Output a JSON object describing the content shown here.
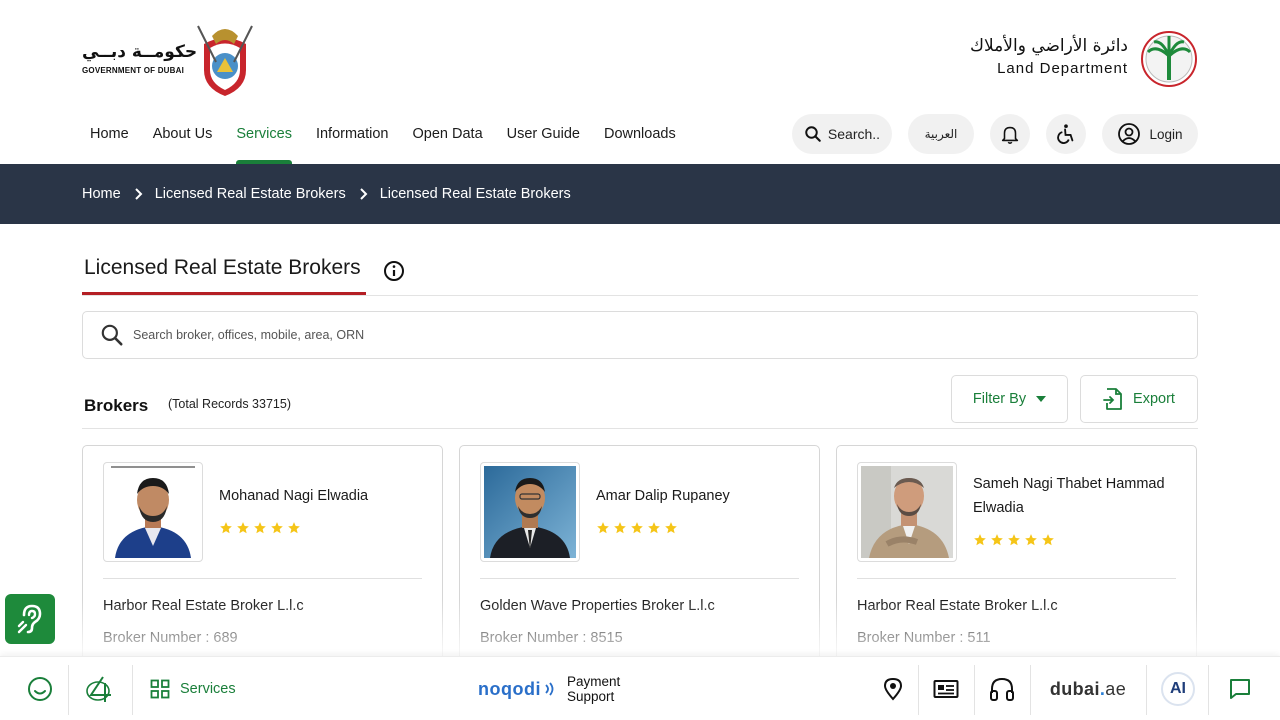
{
  "header": {
    "gov_logo_ar": "حكومــة دبــي",
    "gov_logo_en": "GOVERNMENT OF DUBAI",
    "dld_logo_ar": "دائرة الأراضي والأملاك",
    "dld_logo_en": "Land Department"
  },
  "nav": {
    "items": [
      {
        "label": "Home"
      },
      {
        "label": "About Us"
      },
      {
        "label": "Services"
      },
      {
        "label": "Information"
      },
      {
        "label": "Open Data"
      },
      {
        "label": "User Guide"
      },
      {
        "label": "Downloads"
      }
    ],
    "active": "Services"
  },
  "tools": {
    "search_label": "Search..",
    "language_label": "العربية",
    "login_label": "Login"
  },
  "breadcrumb": {
    "items": [
      "Home",
      "Licensed Real Estate Brokers",
      "Licensed Real Estate Brokers"
    ]
  },
  "page": {
    "title": "Licensed Real Estate Brokers",
    "search_placeholder": "Search broker, offices, mobile, area, ORN",
    "brokers_heading": "Brokers",
    "total_records": "(Total Records 33715)",
    "filter_label": "Filter By",
    "export_label": "Export"
  },
  "brokers": [
    {
      "name": "Mohanad Nagi Elwadia",
      "rating": 5,
      "company": "Harbor Real Estate Broker L.l.c",
      "broker_number": "Broker Number : 689"
    },
    {
      "name": "Amar Dalip Rupaney",
      "rating": 5,
      "company": "Golden Wave Properties Broker L.l.c",
      "broker_number": "Broker Number : 8515"
    },
    {
      "name": "Sameh Nagi Thabet Hammad Elwadia",
      "rating": 5,
      "company": "Harbor Real Estate Broker L.l.c",
      "broker_number": "Broker Number : 511"
    }
  ],
  "bottom_bar": {
    "services_label": "Services",
    "noqodi_label": "noqodi",
    "payment_support_line1": "Payment",
    "payment_support_line2": "Support",
    "dubai_ae_main": "dubai",
    "dubai_ae_dot": ".",
    "dubai_ae_suffix": "ae",
    "ai_label": "AI"
  },
  "colors": {
    "brand_green": "#1a7f3a",
    "breadcrumb_bg": "#2a3547",
    "title_underline": "#b41e24",
    "star": "#f5c518"
  }
}
